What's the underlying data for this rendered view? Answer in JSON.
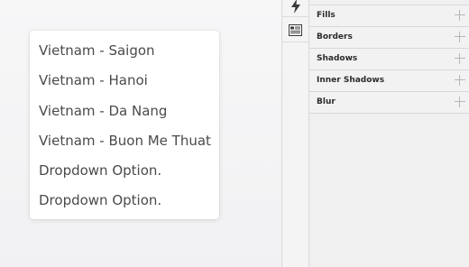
{
  "dropdown": {
    "items": [
      {
        "label": "Vietnam - Saigon"
      },
      {
        "label": "Vietnam - Hanoi"
      },
      {
        "label": "Vietnam - Da Nang"
      },
      {
        "label": "Vietnam - Buon Me Thuat"
      },
      {
        "label": "Dropdown Option."
      },
      {
        "label": "Dropdown Option."
      }
    ]
  },
  "toolbar": {
    "icons": [
      "bolt-icon",
      "layout-list-icon"
    ]
  },
  "inspector": {
    "sections": [
      {
        "label": "Fills"
      },
      {
        "label": "Borders"
      },
      {
        "label": "Shadows"
      },
      {
        "label": "Inner Shadows"
      },
      {
        "label": "Blur"
      }
    ]
  },
  "colors": {
    "panel_bg": "#f0f0f1",
    "divider": "#d8d8da",
    "text_dark": "#2b2b2b",
    "dropdown_text": "#4a4a4a",
    "plus_gray": "#b7b7ba"
  }
}
